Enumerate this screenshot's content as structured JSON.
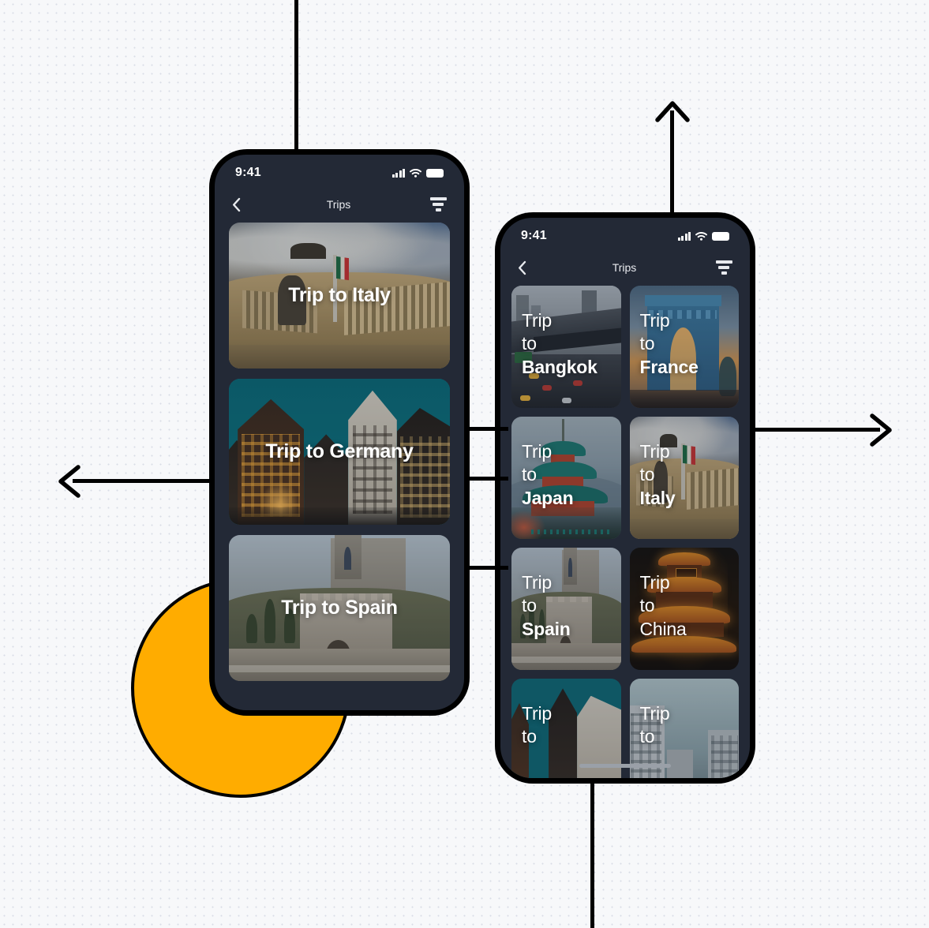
{
  "canvas": {
    "background_color": "#f7f8fa",
    "dot_color": "#d9dde6",
    "accent_orange": "#ffac00",
    "line_color": "#000000",
    "screen_bg": "#232936"
  },
  "phone_list": {
    "status_bar": {
      "time": "9:41",
      "cellular_icon": "signal-bars-icon",
      "wifi_icon": "wifi-icon",
      "battery_icon": "battery-full-icon"
    },
    "nav": {
      "back_icon": "chevron-left-icon",
      "title": "Trips",
      "filter_icon": "filter-icon"
    },
    "cards": [
      {
        "label": "Trip to Italy",
        "photo": "italy-vittoriano-photo",
        "art": "art-italy"
      },
      {
        "label": "Trip to Germany",
        "photo": "germany-halftimbered-photo",
        "art": "art-germany"
      },
      {
        "label": "Trip to Spain",
        "photo": "spain-toledo-photo",
        "art": "art-spain"
      }
    ]
  },
  "phone_grid": {
    "status_bar": {
      "time": "9:41",
      "cellular_icon": "signal-bars-icon",
      "wifi_icon": "wifi-icon",
      "battery_icon": "battery-full-icon"
    },
    "nav": {
      "back_icon": "chevron-left-icon",
      "title": "Trips",
      "filter_icon": "filter-icon"
    },
    "home_indicator": "home-indicator",
    "cards": [
      {
        "line1": "Trip",
        "line2": "to",
        "place": "Bangkok",
        "bold": true,
        "photo": "bangkok-skytrain-photo",
        "art": "art-bangkok"
      },
      {
        "line1": "Trip",
        "line2": "to",
        "place": "France",
        "bold": true,
        "photo": "france-arc-de-triomphe-photo",
        "art": "art-france"
      },
      {
        "line1": "Trip",
        "line2": "to",
        "place": "Japan",
        "bold": true,
        "photo": "japan-pagoda-photo",
        "art": "art-japan"
      },
      {
        "line1": "Trip",
        "line2": "to",
        "place": "Italy",
        "bold": true,
        "photo": "italy-vittoriano-photo",
        "art": "art-italy"
      },
      {
        "line1": "Trip",
        "line2": "to",
        "place": "Spain",
        "bold": true,
        "photo": "spain-toledo-photo",
        "art": "art-spain"
      },
      {
        "line1": "Trip",
        "line2": "to",
        "place": "China",
        "bold": false,
        "photo": "china-pagoda-photo",
        "art": "art-china"
      },
      {
        "line1": "Trip",
        "line2": "to",
        "place": "",
        "bold": false,
        "photo": "germany-halftimbered-photo",
        "art": "art-germany2"
      },
      {
        "line1": "Trip",
        "line2": "to",
        "place": "",
        "bold": false,
        "photo": "city-buildings-photo",
        "art": "art-city"
      }
    ]
  },
  "connectors": {
    "top_line": "vertical-line-top",
    "bottom_line": "vertical-line-bottom",
    "up_arrow": "arrow-up",
    "right_arrow": "arrow-right",
    "left_arrow": "arrow-left",
    "link_lines": [
      "link-line-1",
      "link-line-2",
      "link-line-3"
    ]
  },
  "decor": {
    "circle": "orange-circle-decoration"
  }
}
